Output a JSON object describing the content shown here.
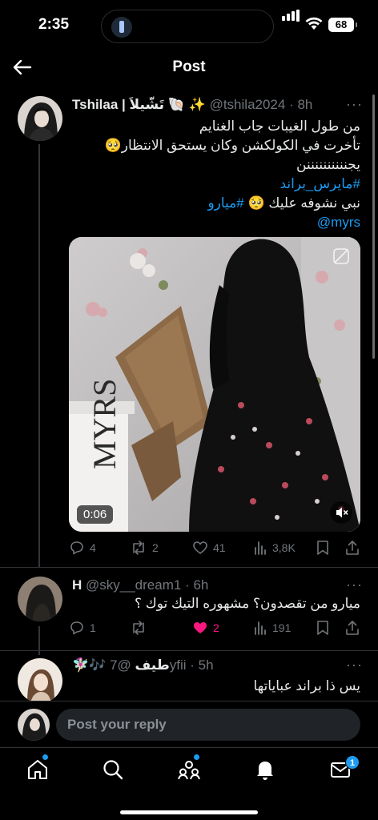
{
  "status_bar": {
    "time": "2:35",
    "battery": "68"
  },
  "header": {
    "title": "Post"
  },
  "main_tweet": {
    "name": "Tshilaa | تَشّيلاَ 🐚 ✨",
    "handle": "@tshila2024",
    "time": "8h",
    "lines": [
      "من طول الغيبات جاب الغنايم",
      "تأخرت في الكولكشن وكان يستحق الانتظار🥺",
      "يجننننننننننن"
    ],
    "hashtag1": "#مايرس_براند",
    "line5_text": "نبي نشوفه عليك 🥺 ",
    "hashtag2": "#ميارو",
    "mention": "@myrs",
    "video_duration": "0:06",
    "stats": {
      "replies": "4",
      "reposts": "2",
      "likes": "41",
      "views": "3,8K"
    }
  },
  "reply1": {
    "name": "H",
    "handle": "@sky__dream1",
    "time": "6h",
    "text": "ميارو من تقصدون؟ مشهوره التيك توك ؟",
    "stats": {
      "replies": "1",
      "reposts": "",
      "likes": "2",
      "views": "191"
    }
  },
  "reply2": {
    "name": "🧚🏻‍♀️🎶 طيف",
    "handle": "@7yfii",
    "time": "5h",
    "text": "يس ذا براند عباياتها"
  },
  "reply_bar": {
    "placeholder": "Post your reply"
  },
  "tabbar": {
    "messages_badge": "1"
  },
  "colors": {
    "accent": "#1d9bf0",
    "like": "#f91880",
    "muted": "#71767b"
  }
}
